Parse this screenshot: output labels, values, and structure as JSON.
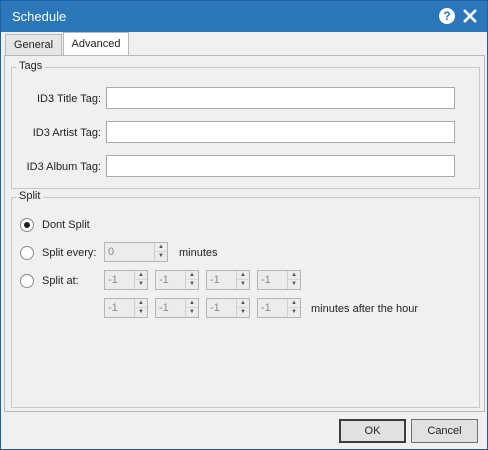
{
  "window": {
    "title": "Schedule"
  },
  "tabs": [
    {
      "label": "General"
    },
    {
      "label": "Advanced"
    }
  ],
  "tags": {
    "legend": "Tags",
    "title_label": "ID3 Title Tag:",
    "title_value": "",
    "artist_label": "ID3 Artist Tag:",
    "artist_value": "",
    "album_label": "ID3 Album Tag:",
    "album_value": ""
  },
  "split": {
    "legend": "Split",
    "dont_split_label": "Dont Split",
    "split_every_label": "Split every:",
    "split_every_value": "0",
    "split_every_unit": "minutes",
    "split_at_label": "Split at:",
    "split_at_row1": [
      "-1",
      "-1",
      "-1",
      "-1"
    ],
    "split_at_row2": [
      "-1",
      "-1",
      "-1",
      "-1"
    ],
    "split_at_unit": "minutes after the hour",
    "selected": "Dont Split"
  },
  "buttons": {
    "ok": "OK",
    "cancel": "Cancel"
  },
  "icons": {
    "help": "help-icon",
    "close": "close-icon"
  },
  "colors": {
    "titlebar": "#2b77b9",
    "window_bg": "#f0f0f0"
  }
}
